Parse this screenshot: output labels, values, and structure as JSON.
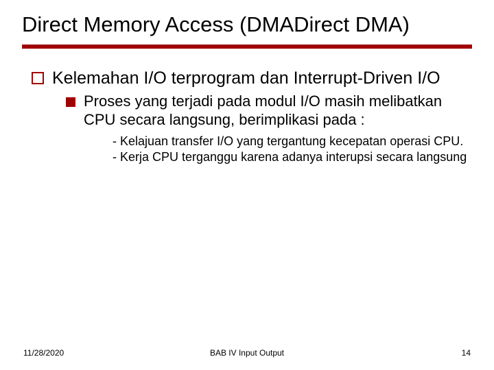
{
  "title": "Direct Memory Access (DMADirect DMA)",
  "lvl1": "Kelemahan I/O terprogram dan Interrupt-Driven I/O",
  "lvl2": "Proses yang terjadi pada modul I/O masih melibatkan CPU secara langsung, berimplikasi pada :",
  "lvl3a": "- Kelajuan transfer I/O yang tergantung kecepatan operasi CPU.",
  "lvl3b": "- Kerja CPU terganggu karena adanya interupsi secara langsung",
  "footer": {
    "date": "11/28/2020",
    "center": "BAB IV   Input Output",
    "page": "14"
  }
}
